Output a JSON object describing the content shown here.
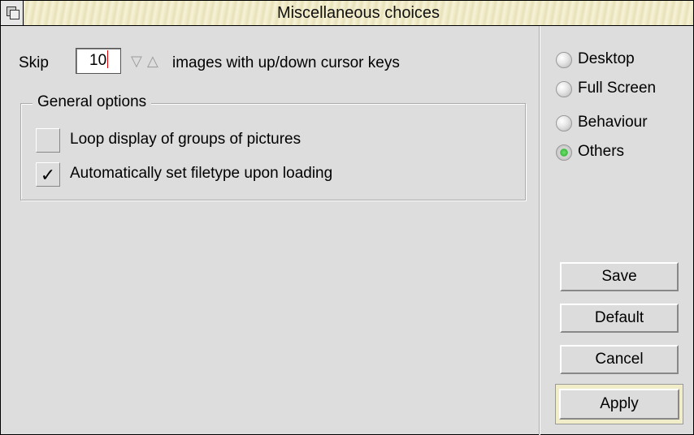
{
  "window": {
    "title": "Miscellaneous choices"
  },
  "skip": {
    "prefix": "Skip",
    "value": "10",
    "suffix": "images with up/down cursor keys",
    "down_arrow": "▽",
    "up_arrow": "△"
  },
  "general_options": {
    "title": "General options",
    "options": [
      {
        "label": "Loop display of groups of pictures",
        "checked": false,
        "mark": ""
      },
      {
        "label": "Automatically set filetype upon loading",
        "checked": true,
        "mark": "✓"
      }
    ]
  },
  "sections": [
    {
      "label": "Desktop",
      "selected": false
    },
    {
      "label": "Full Screen",
      "selected": false
    },
    {
      "label": "Behaviour",
      "selected": false
    },
    {
      "label": "Others",
      "selected": true
    }
  ],
  "buttons": {
    "save": "Save",
    "default": "Default",
    "cancel": "Cancel",
    "apply": "Apply"
  },
  "colors": {
    "title_bar": "#f1ecc7",
    "window_bg": "#dddddd",
    "radio_selected": "#3cbc3c",
    "caret": "#dd0000"
  }
}
